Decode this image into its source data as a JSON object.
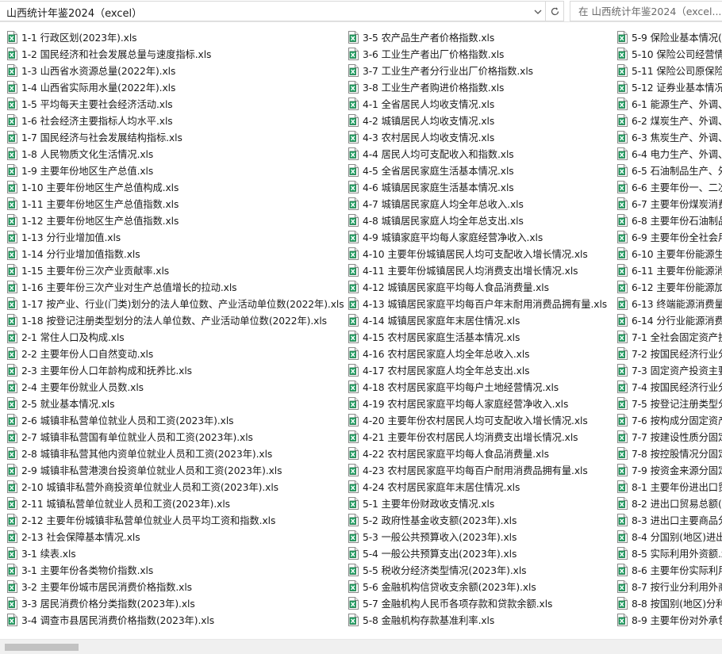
{
  "address": {
    "path": "山西统计年鉴2024（excel）",
    "search_placeholder": "在 山西统计年鉴2024（excel..."
  },
  "icons": {
    "file": "excel-file-icon",
    "chevron": "chevron-down-icon",
    "refresh": "refresh-icon"
  },
  "colors": {
    "excel_green": "#1e7145",
    "scroll_thumb": "#c2c2c2"
  },
  "columns": [
    [
      "1-1 行政区划(2023年).xls",
      "1-2 国民经济和社会发展总量与速度指标.xls",
      "1-3 山西省水资源总量(2022年).xls",
      "1-4 山西省实际用水量(2022年).xls",
      "1-5 平均每天主要社会经济活动.xls",
      "1-6 社会经济主要指标人均水平.xls",
      "1-7 国民经济与社会发展结构指标.xls",
      "1-8 人民物质文化生活情况.xls",
      "1-9 主要年份地区生产总值.xls",
      "1-10 主要年份地区生产总值构成.xls",
      "1-11 主要年份地区生产总值指数.xls",
      "1-12 主要年份地区生产总值指数.xls",
      "1-13 分行业增加值.xls",
      "1-14 分行业增加值指数.xls",
      "1-15 主要年份三次产业贡献率.xls",
      "1-16 主要年份三次产业对生产总值增长的拉动.xls",
      "1-17 按产业、行业(门类)划分的法人单位数、产业活动单位数(2022年).xls",
      "1-18 按登记注册类型划分的法人单位数、产业活动单位数(2022年).xls",
      "2-1 常住人口及构成.xls",
      "2-2 主要年份人口自然变动.xls",
      "2-3 主要年份人口年龄构成和抚养比.xls",
      "2-4 主要年份就业人员数.xls",
      "2-5 就业基本情况.xls",
      "2-6 城镇非私营单位就业人员和工资(2023年).xls",
      "2-7 城镇非私营国有单位就业人员和工资(2023年).xls",
      "2-8 城镇非私营其他内资单位就业人员和工资(2023年).xls",
      "2-9 城镇非私营港澳台投资单位就业人员和工资(2023年).xls",
      "2-10 城镇非私营外商投资单位就业人员和工资(2023年).xls",
      "2-11 城镇私营单位就业人员和工资(2023年).xls",
      "2-12 主要年份城镇非私营单位就业人员平均工资和指数.xls",
      "2-13 社会保障基本情况.xls",
      "3-1 续表.xls",
      "3-1 主要年份各类物价指数.xls",
      "3-2 主要年份城市居民消费价格指数.xls",
      "3-3 居民消费价格分类指数(2023年).xls",
      "3-4 调查市县居民消费价格指数(2023年).xls"
    ],
    [
      "3-5 农产品生产者价格指数.xls",
      "3-6 工业生产者出厂价格指数.xls",
      "3-7 工业生产者分行业出厂价格指数.xls",
      "3-8 工业生产者购进价格指数.xls",
      "4-1 全省居民人均收支情况.xls",
      "4-2 城镇居民人均收支情况.xls",
      "4-3 农村居民人均收支情况.xls",
      "4-4 居民人均可支配收入和指数.xls",
      "4-5 全省居民家庭生活基本情况.xls",
      "4-6 城镇居民家庭生活基本情况.xls",
      "4-7 城镇居民家庭人均全年总收入.xls",
      "4-8 城镇居民家庭人均全年总支出.xls",
      "4-9 城镇家庭平均每人家庭经营净收入.xls",
      "4-10 主要年份城镇居民人均可支配收入增长情况.xls",
      "4-11 主要年份城镇居民人均消费支出增长情况.xls",
      "4-12 城镇居民家庭平均每人食品消费量.xls",
      "4-13 城镇居民家庭平均每百户年末耐用消费品拥有量.xls",
      "4-14 城镇居民家庭年末居住情况.xls",
      "4-15 农村居民家庭生活基本情况.xls",
      "4-16 农村居民家庭人均全年总收入.xls",
      "4-17 农村居民家庭人均全年总支出.xls",
      "4-18 农村居民家庭平均每户土地经营情况.xls",
      "4-19 农村居民家庭平均每人家庭经营净收入.xls",
      "4-20 主要年份农村居民人均可支配收入增长情况.xls",
      "4-21 主要年份农村居民人均消费支出增长情况.xls",
      "4-22 农村居民家庭平均每人食品消费量.xls",
      "4-23 农村居民家庭平均每百户耐用消费品拥有量.xls",
      "4-24 农村居民家庭年末居住情况.xls",
      "5-1 主要年份财政收支情况.xls",
      "5-2 政府性基金收支额(2023年).xls",
      "5-3 一般公共预算收入(2023年).xls",
      "5-4 一般公共预算支出(2023年).xls",
      "5-5 税收分经济类型情况(2023年).xls",
      "5-6 金融机构信贷收支余额(2023年).xls",
      "5-7 金融机构人民币各项存款和贷款余额.xls",
      "5-8 金融机构存款基准利率.xls"
    ],
    [
      "5-9 保险业基本情况(2",
      "5-10 保险公司经营情",
      "5-11 保险公司原保险",
      "5-12 证券业基本情况",
      "6-1 能源生产、外调、",
      "6-2 煤炭生产、外调、",
      "6-3 焦炭生产、外调、",
      "6-4 电力生产、外调、",
      "6-5 石油制品生产、外",
      "6-6 主要年份一、二次",
      "6-7 主要年份煤炭消费",
      "6-8 主要年份石油制品",
      "6-9 主要年份全社会用",
      "6-10 主要年份能源生",
      "6-11 主要年份能源消",
      "6-12 主要年份能源加",
      "6-13 终端能源消费量",
      "6-14 分行业能源消费",
      "7-1 全社会固定资产投",
      "7-2 按国民经济行业分",
      "7-3 固定资产投资主要",
      "7-4 按国民经济行业分",
      "7-5 按登记注册类型分",
      "7-6 按构成分固定资产",
      "7-7 按建设性质分固定",
      "7-8 按控股情况分固定",
      "7-9 按资金来源分固定",
      "8-1 主要年份进出口贸",
      "8-2 进出口贸易总额(2",
      "8-3 进出口主要商品分",
      "8-4 分国别(地区)进出",
      "8-5 实际利用外资额.x",
      "8-6 主要年份实际利用",
      "8-7 按行业分利用外商",
      "8-8 按国别(地区)分利",
      "8-9 主要年份对外承包"
    ]
  ]
}
